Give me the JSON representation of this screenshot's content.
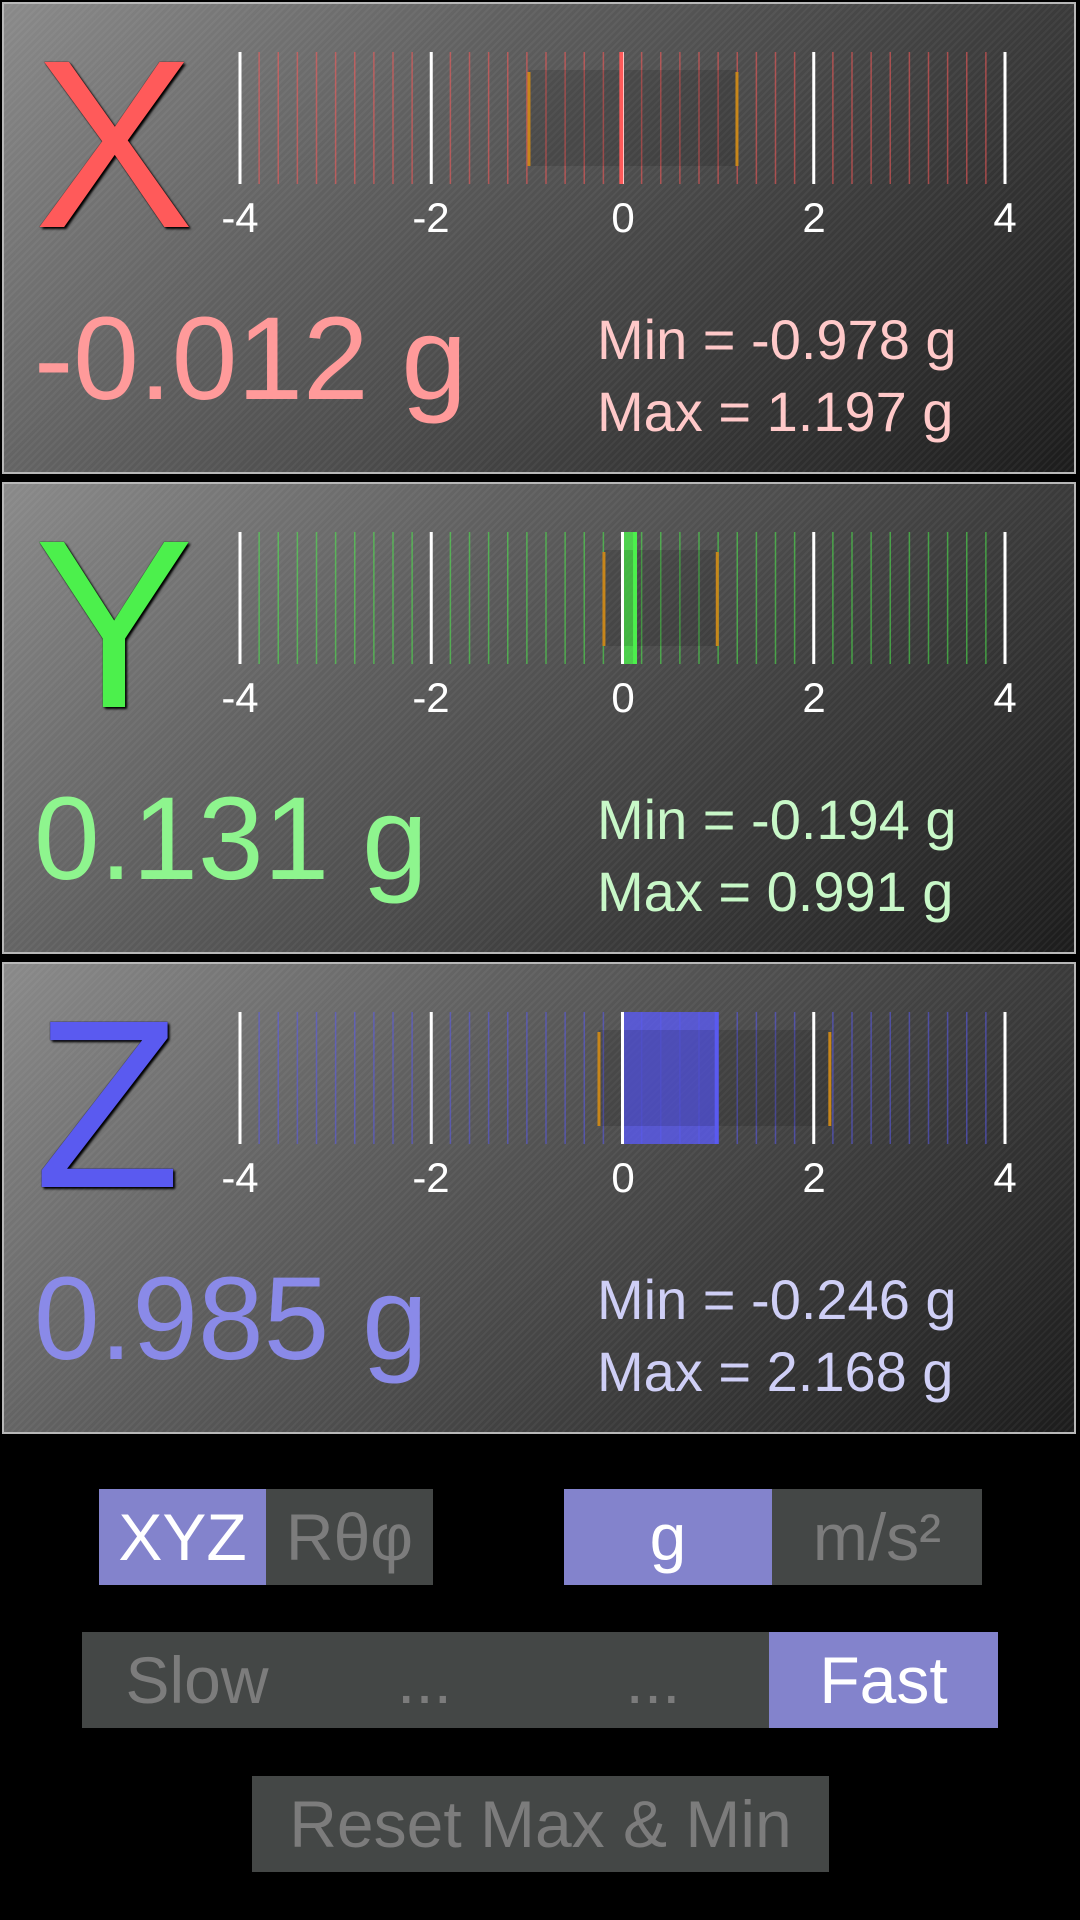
{
  "axes": [
    {
      "id": "x",
      "letter": "X",
      "color": "#ff5a5a",
      "text_color": "#ff9a9a",
      "minmax_color": "#ffc9c9",
      "value": -0.012,
      "value_text": "-0.012 g",
      "min_value": -0.978,
      "max_value": 1.197,
      "min_text": "Min = -0.978 g",
      "max_text": "Max = 1.197 g"
    },
    {
      "id": "y",
      "letter": "Y",
      "color": "#4cf04c",
      "text_color": "#8ef58e",
      "minmax_color": "#c8f8c8",
      "value": 0.131,
      "value_text": "0.131 g",
      "min_value": -0.194,
      "max_value": 0.991,
      "min_text": "Min = -0.194 g",
      "max_text": "Max = 0.991 g"
    },
    {
      "id": "z",
      "letter": "Z",
      "color": "#5a5af0",
      "text_color": "#8a8ae8",
      "minmax_color": "#cfcff6",
      "value": 0.985,
      "value_text": "0.985 g",
      "min_value": -0.246,
      "max_value": 2.168,
      "min_text": "Min = -0.246 g",
      "max_text": "Max = 2.168 g"
    }
  ],
  "gauge": {
    "range": [
      -4,
      4
    ],
    "tick_labels": [
      "-4",
      "-2",
      "0",
      "2",
      "4"
    ],
    "minor_step": 0.2,
    "minmax_marker_color": "#c8861a"
  },
  "controls": {
    "coord_toggle": {
      "options": [
        "XYZ",
        "Rθφ"
      ],
      "selected": "XYZ"
    },
    "unit_toggle": {
      "options": [
        "g",
        "m/s²"
      ],
      "selected": "g"
    },
    "speed": {
      "options": [
        "Slow",
        "...",
        "...",
        "Fast"
      ],
      "selected": "Fast"
    },
    "reset_label": "Reset Max & Min",
    "accent_color": "#8383cc",
    "inactive_color": "#444746"
  }
}
